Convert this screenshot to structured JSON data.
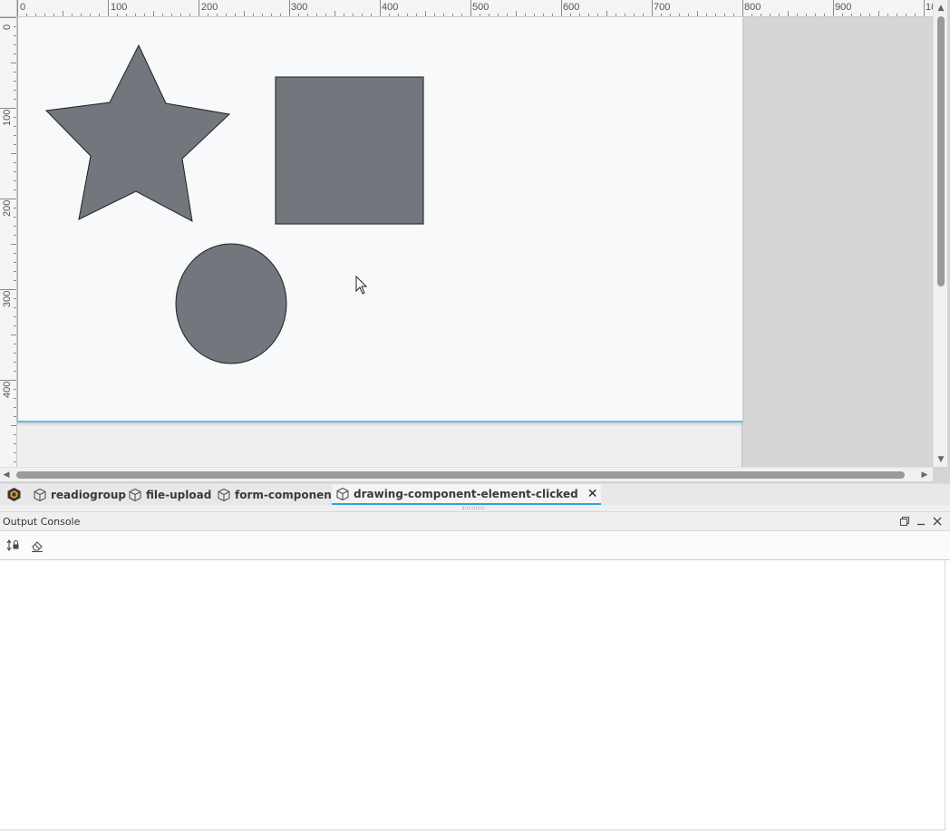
{
  "ruler": {
    "horizontal_labels": [
      "0",
      "100",
      "200",
      "300",
      "400",
      "500",
      "600",
      "700",
      "800",
      "900",
      "10"
    ],
    "vertical_labels": [
      "0",
      "100",
      "200",
      "300",
      "400"
    ]
  },
  "canvas": {
    "shapes": [
      {
        "name": "star",
        "fill": "#72767d",
        "stroke": "#222222"
      },
      {
        "name": "square",
        "fill": "#72767d",
        "stroke": "#333333"
      },
      {
        "name": "circle",
        "fill": "#72767d",
        "stroke": "#222222"
      }
    ]
  },
  "tabs": [
    {
      "label": "readiogroup",
      "icon": "cube-icon",
      "active": false
    },
    {
      "label": "file-upload",
      "icon": "cube-icon",
      "active": false
    },
    {
      "label": "form-component",
      "icon": "cube-icon",
      "active": false
    },
    {
      "label": "drawing-component-element-clicked",
      "icon": "cube-icon",
      "active": true
    }
  ],
  "console": {
    "title": "Output Console",
    "toolbar": [
      "scroll-lock-icon",
      "eraser-icon"
    ]
  },
  "colors": {
    "accent": "#29a3e0",
    "canvas_border": "#5bc0e8",
    "shape_fill": "#72767d"
  }
}
